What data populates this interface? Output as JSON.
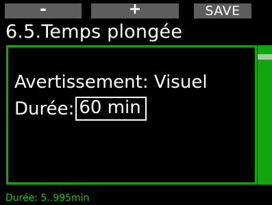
{
  "softkeys": {
    "minus_label": "-",
    "plus_label": "+",
    "save_label": "SAVE"
  },
  "header": {
    "title": "6.5.Temps plongée"
  },
  "settings": {
    "warning_text": "Avertissement: Visuel",
    "duration_label": "Durée:",
    "duration_value": "60 min"
  },
  "footer": {
    "hint": "Durée: 5..995min"
  },
  "colors": {
    "background": "#000000",
    "accent_green": "#11a50e",
    "softkey_gray": "#5d5d5d",
    "hint_green": "#16c515"
  }
}
